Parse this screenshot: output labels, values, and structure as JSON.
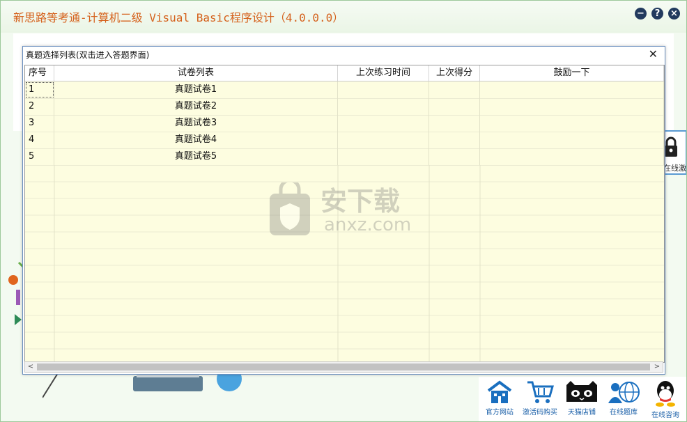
{
  "app": {
    "title": "新思路等考通-计算机二级 Visual Basic程序设计（4.0.0.0）",
    "buttons": {
      "minimize": "−",
      "help": "?",
      "close": "×"
    }
  },
  "side_panel": {
    "lock_label": "在线激活"
  },
  "bottom_bar": {
    "items": [
      {
        "label": "官方网站",
        "icon": "house-icon"
      },
      {
        "label": "激活码购买",
        "icon": "shopping-cart-icon"
      },
      {
        "label": "天猫店铺",
        "icon": "tmall-cat-icon"
      },
      {
        "label": "在线题库",
        "icon": "globe-user-icon"
      },
      {
        "label": "在线咨询",
        "icon": "qq-penguin-icon"
      }
    ]
  },
  "dialog": {
    "title": "真题选择列表(双击进入答题界面)",
    "close": "✕",
    "columns": [
      "序号",
      "试卷列表",
      "上次练习时间",
      "上次得分",
      "鼓励一下"
    ],
    "rows": [
      {
        "index": "1",
        "name": "真题试卷1",
        "last_time": "",
        "last_score": "",
        "encourage": ""
      },
      {
        "index": "2",
        "name": "真题试卷2",
        "last_time": "",
        "last_score": "",
        "encourage": ""
      },
      {
        "index": "3",
        "name": "真题试卷3",
        "last_time": "",
        "last_score": "",
        "encourage": ""
      },
      {
        "index": "4",
        "name": "真题试卷4",
        "last_time": "",
        "last_score": "",
        "encourage": ""
      },
      {
        "index": "5",
        "name": "真题试卷5",
        "last_time": "",
        "last_score": "",
        "encourage": ""
      }
    ],
    "scroll_left": "<",
    "scroll_right": ">"
  },
  "watermark": {
    "title": "安下载",
    "subtitle": "anxz.com"
  },
  "colors": {
    "title_orange": "#d5611c",
    "grid_bg": "#fdfde0",
    "link_blue": "#1a5fa8"
  }
}
